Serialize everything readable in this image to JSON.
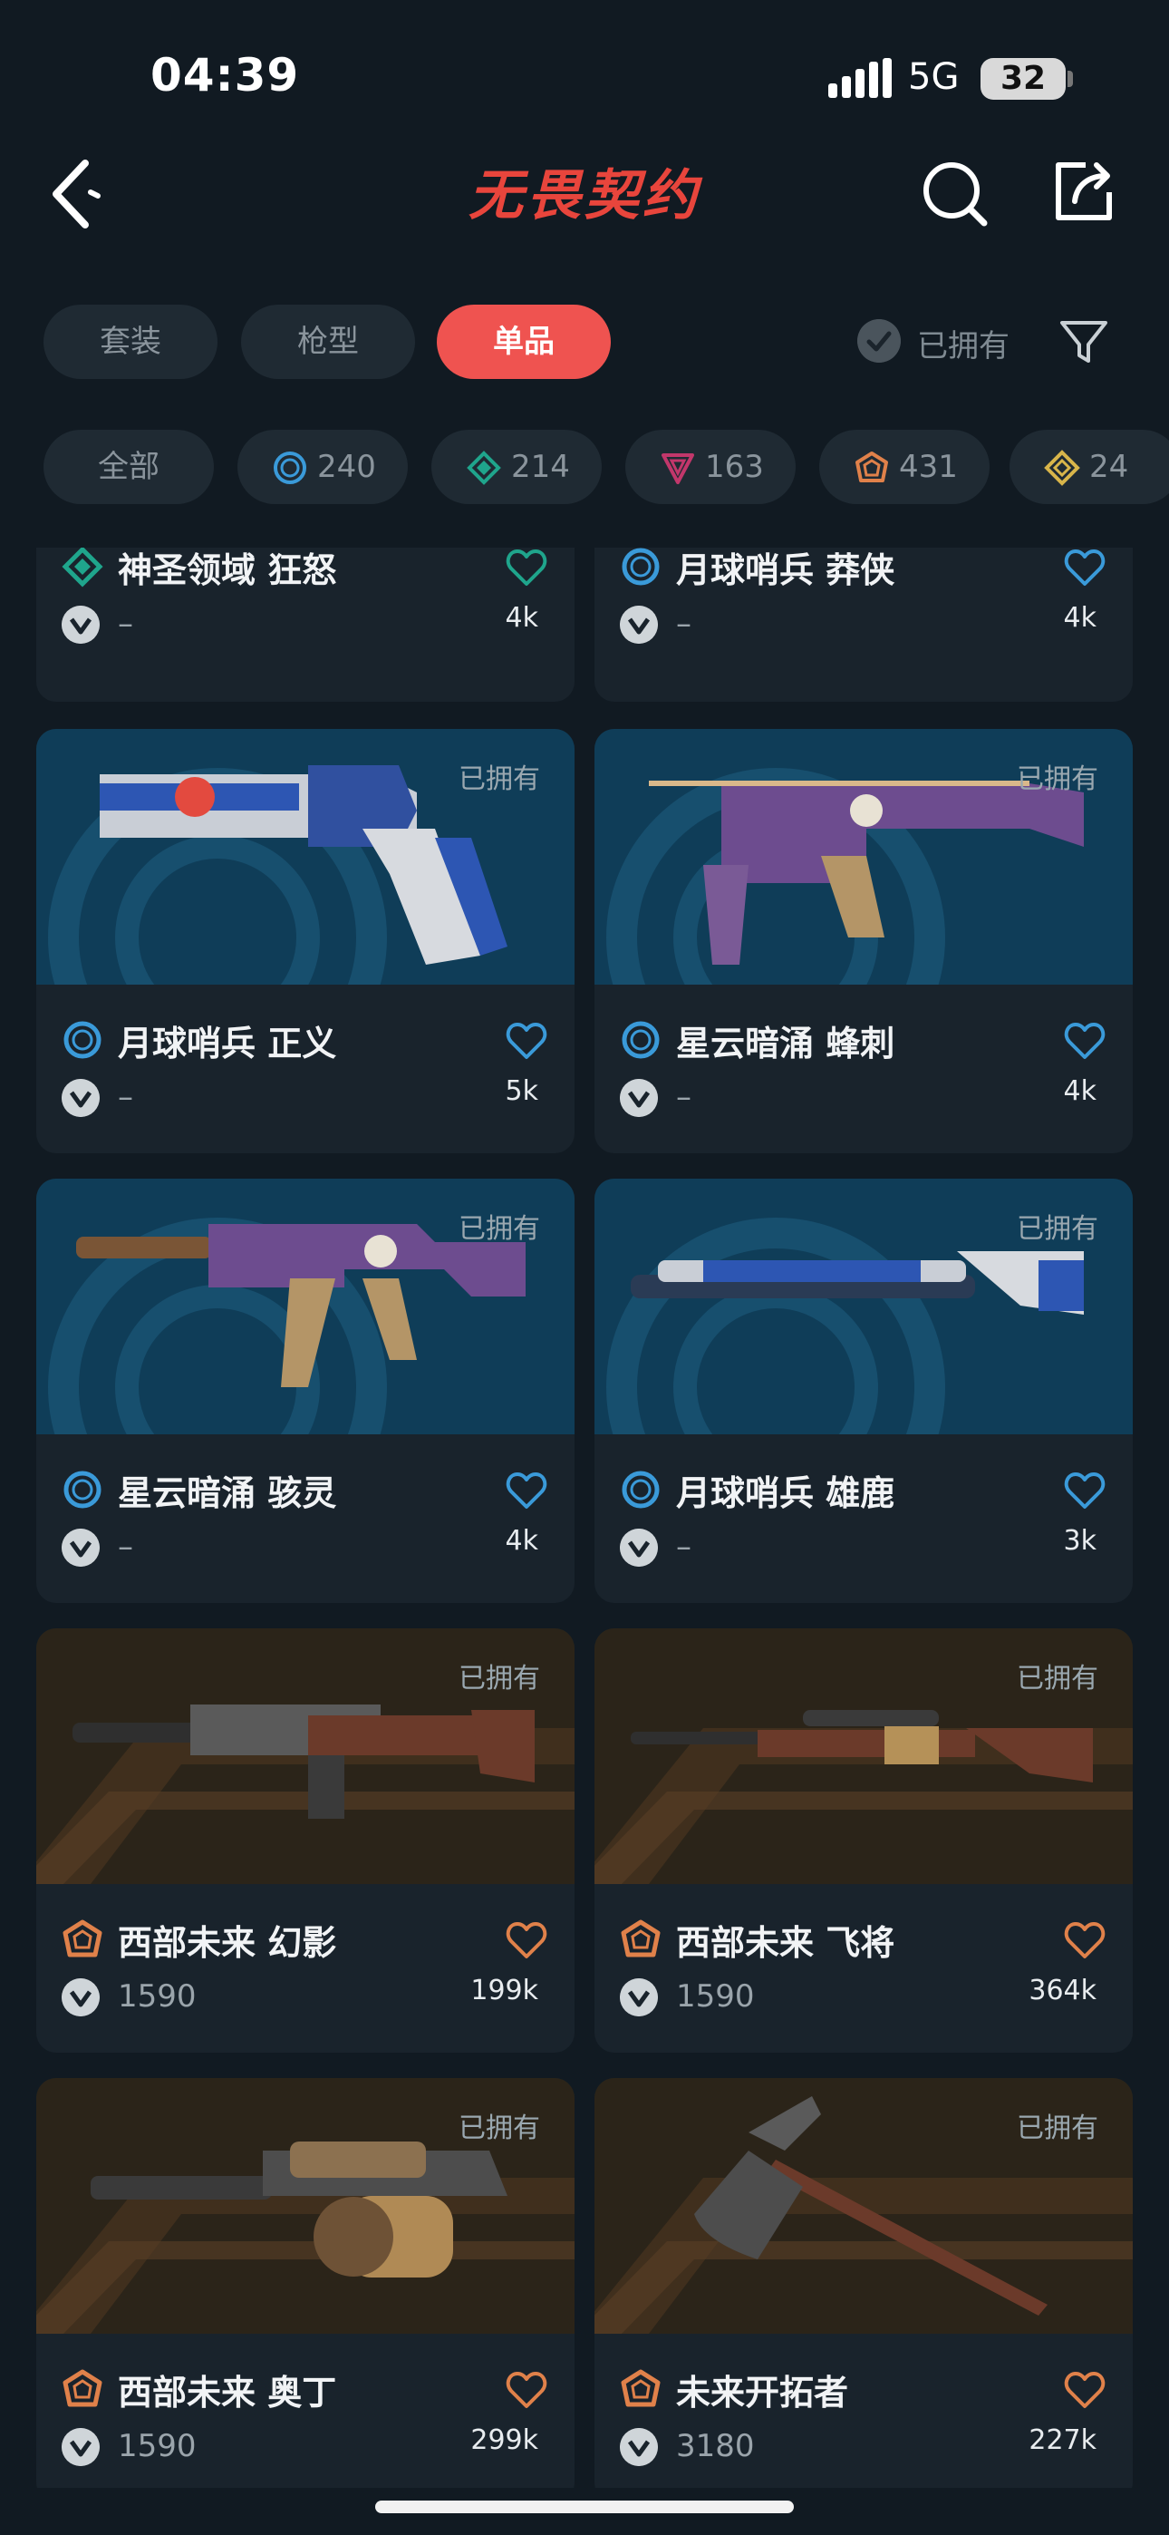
{
  "status_bar": {
    "time": "04:39",
    "network": "5G",
    "battery": "32"
  },
  "header": {
    "title": "无畏契约"
  },
  "tabs": [
    {
      "label": "套装",
      "active": false
    },
    {
      "label": "枪型",
      "active": false
    },
    {
      "label": "单品",
      "active": true
    }
  ],
  "owned_filter": {
    "label": "已拥有"
  },
  "rarity_chips": [
    {
      "label": "全部",
      "icon": ""
    },
    {
      "label": "240",
      "icon": "select-tier-icon",
      "color": "#3a9ad9"
    },
    {
      "label": "214",
      "icon": "deluxe-tier-icon",
      "color": "#1fa58c"
    },
    {
      "label": "163",
      "icon": "premium-tier-icon",
      "color": "#c2376b"
    },
    {
      "label": "431",
      "icon": "exclusive-tier-icon",
      "color": "#e0814a"
    },
    {
      "label": "24",
      "icon": "ultra-tier-icon",
      "color": "#d8b54a"
    }
  ],
  "colors": {
    "accent": "#ef5350",
    "select": "#3a9ad9",
    "deluxe": "#1fa58c",
    "exclusive": "#e0814a"
  },
  "owned_tag_label": "已拥有",
  "items": [
    {
      "name": "神圣领域 狂怒",
      "price": "–",
      "likes": "4k",
      "tier": "deluxe",
      "heart_color": "#1fa58c",
      "owned": false,
      "image": ""
    },
    {
      "name": "月球哨兵 莽侠",
      "price": "–",
      "likes": "4k",
      "tier": "select",
      "heart_color": "#3a9ad9",
      "owned": false,
      "image": ""
    },
    {
      "name": "月球哨兵 正义",
      "price": "–",
      "likes": "5k",
      "tier": "select",
      "heart_color": "#3a9ad9",
      "owned": true,
      "image": "revolver"
    },
    {
      "name": "星云暗涌 蜂刺",
      "price": "–",
      "likes": "4k",
      "tier": "select",
      "heart_color": "#3a9ad9",
      "owned": true,
      "image": "smg"
    },
    {
      "name": "星云暗涌 骇灵",
      "price": "–",
      "likes": "4k",
      "tier": "select",
      "heart_color": "#3a9ad9",
      "owned": true,
      "image": "spectre"
    },
    {
      "name": "月球哨兵 雄鹿",
      "price": "–",
      "likes": "3k",
      "tier": "select",
      "heart_color": "#3a9ad9",
      "owned": true,
      "image": "shotgun"
    },
    {
      "name": "西部未来 幻影",
      "price": "1590",
      "likes": "199k",
      "tier": "exclusive",
      "heart_color": "#e0814a",
      "owned": true,
      "image": "rifle"
    },
    {
      "name": "西部未来 飞将",
      "price": "1590",
      "likes": "364k",
      "tier": "exclusive",
      "heart_color": "#e0814a",
      "owned": true,
      "image": "sniper"
    },
    {
      "name": "西部未来 奥丁",
      "price": "1590",
      "likes": "299k",
      "tier": "exclusive",
      "heart_color": "#e0814a",
      "owned": true,
      "image": "minigun"
    },
    {
      "name": "未来开拓者",
      "price": "3180",
      "likes": "227k",
      "tier": "exclusive",
      "heart_color": "#e0814a",
      "owned": true,
      "image": "axe"
    }
  ]
}
